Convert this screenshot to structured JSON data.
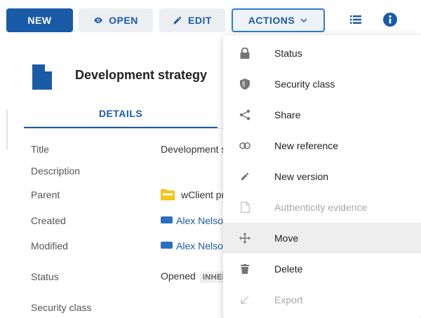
{
  "toolbar": {
    "new_label": "NEW",
    "open_label": "OPEN",
    "edit_label": "EDIT",
    "actions_label": "ACTIONS"
  },
  "document": {
    "title": "Development strategy",
    "tab_details": "DETAILS"
  },
  "properties": [
    {
      "label": "Title",
      "value": "Development s"
    },
    {
      "label": "Description",
      "value": ""
    },
    {
      "label": "Parent",
      "value": "wClient pr"
    },
    {
      "label": "Created",
      "value": "Alex Nelso"
    },
    {
      "label": "Modified",
      "value": "Alex Nelso"
    },
    {
      "label": "Status",
      "value": "Opened",
      "badge": "INHER"
    },
    {
      "label": "Security class",
      "value": ""
    }
  ],
  "menu": {
    "items": [
      {
        "label": "Status",
        "icon": "lock-icon",
        "disabled": false
      },
      {
        "label": "Security class",
        "icon": "shield-icon",
        "disabled": false
      },
      {
        "label": "Share",
        "icon": "share-icon",
        "disabled": false
      },
      {
        "label": "New reference",
        "icon": "link-icon",
        "disabled": false
      },
      {
        "label": "New version",
        "icon": "pencil-icon",
        "disabled": false
      },
      {
        "label": "Authenticity evidence",
        "icon": "document-icon",
        "disabled": true
      },
      {
        "label": "Move",
        "icon": "move-icon",
        "disabled": false,
        "highlighted": true
      },
      {
        "label": "Delete",
        "icon": "trash-icon",
        "disabled": false
      },
      {
        "label": "Export",
        "icon": "export-arrow-icon",
        "disabled": true
      }
    ]
  },
  "colors": {
    "primary": "#1a5ba8",
    "folder": "#f5c518",
    "menu_highlight": "#eeeeee"
  }
}
